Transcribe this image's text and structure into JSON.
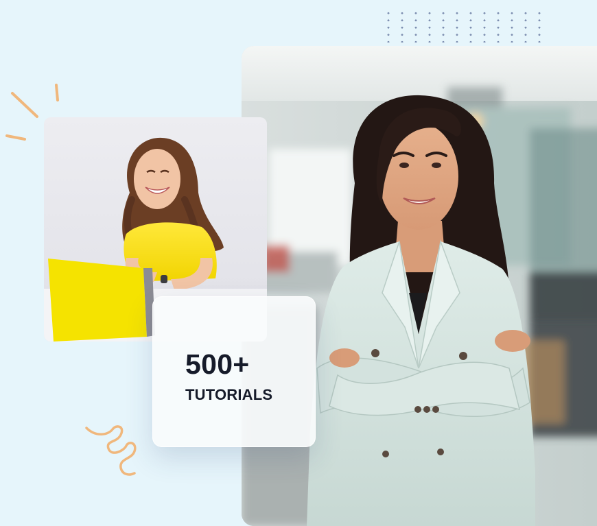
{
  "stats": {
    "count": "500+",
    "label": "TUTORIALS"
  },
  "images": {
    "main": "smiling-businesswoman-photo",
    "secondary": "laughing-woman-with-laptop-photo"
  },
  "colors": {
    "background": "#e6f5fb",
    "accent_orange": "#f0b77c",
    "dots": "#7e8fb1",
    "text_dark": "#161b2a",
    "laptop_yellow": "#f5e300"
  }
}
